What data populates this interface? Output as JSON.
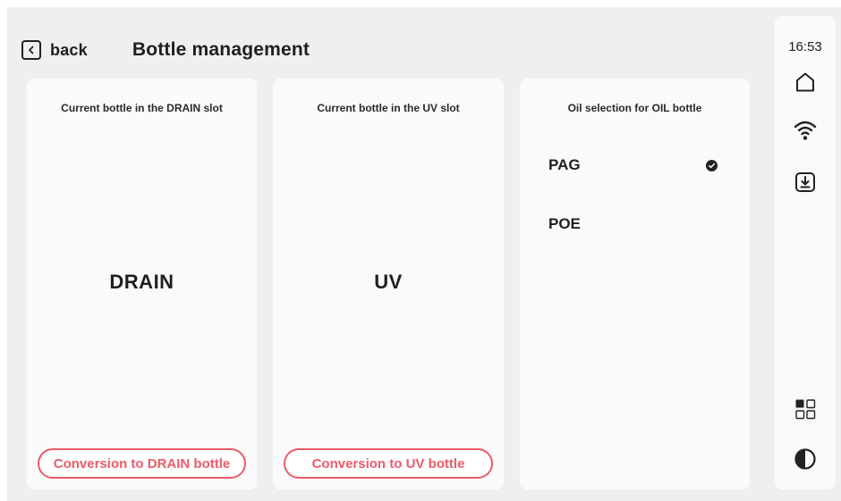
{
  "header": {
    "back_label": "back",
    "title": "Bottle management"
  },
  "drain_card": {
    "title": "Current bottle in the DRAIN slot",
    "value": "DRAIN",
    "button_label": "Conversion to DRAIN bottle"
  },
  "uv_card": {
    "title": "Current bottle in the UV slot",
    "value": "UV",
    "button_label": "Conversion to UV bottle"
  },
  "oil_card": {
    "title": "Oil selection for OIL bottle",
    "options": [
      {
        "label": "PAG",
        "selected": true
      },
      {
        "label": "POE",
        "selected": false
      }
    ]
  },
  "status_bar": {
    "time": "16:53",
    "icons": [
      "home-icon",
      "wifi-icon",
      "download-icon",
      "apps-grid-icon",
      "contrast-icon"
    ]
  },
  "colors": {
    "accent": "#ef5a69",
    "background": "#efefef",
    "card": "#fafafa",
    "text": "#1f1f1f"
  }
}
